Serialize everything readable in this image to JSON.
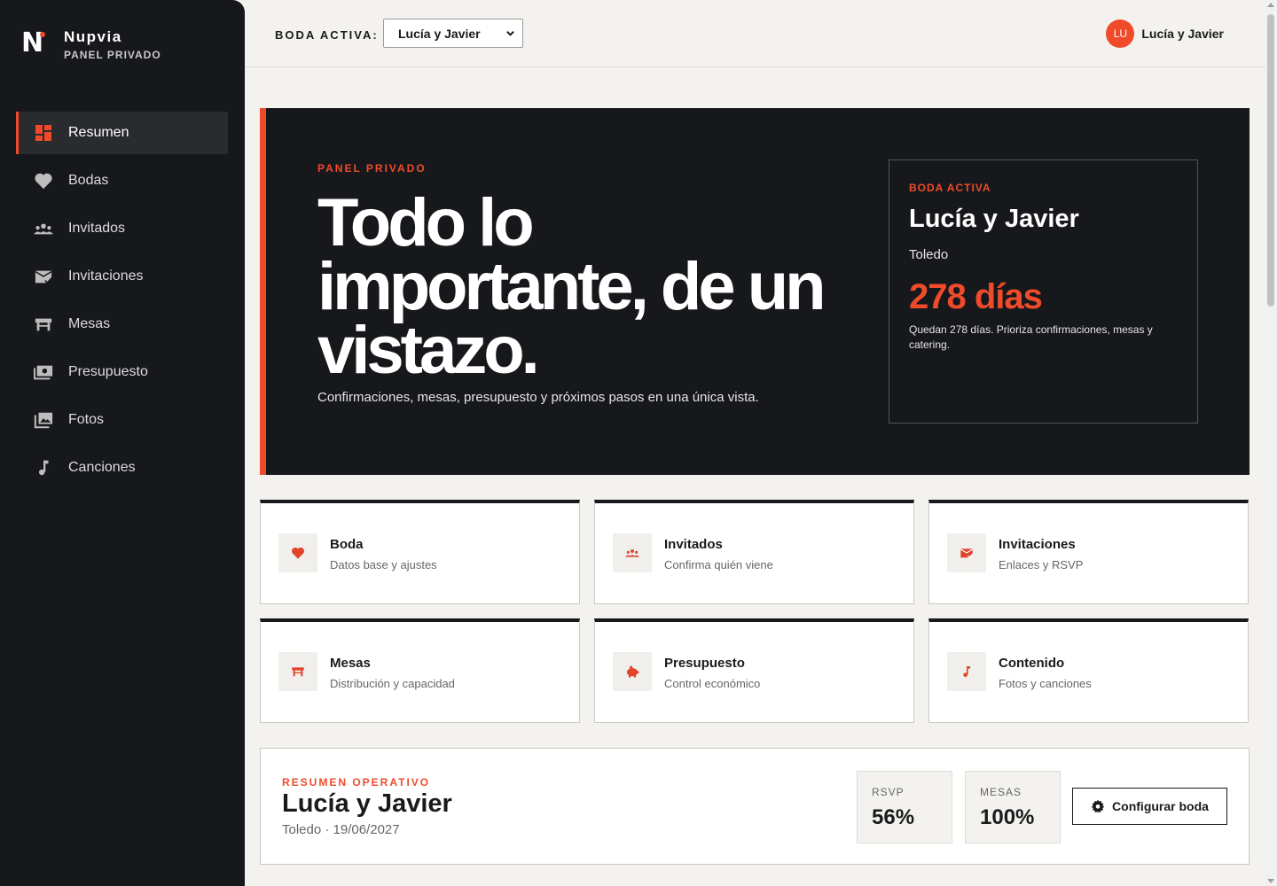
{
  "brand": {
    "name": "Nupvia",
    "subtitle": "PANEL PRIVADO"
  },
  "sidebar": {
    "items": [
      {
        "label": "Resumen",
        "icon": "dashboard-icon",
        "active": true
      },
      {
        "label": "Bodas",
        "icon": "heart-icon"
      },
      {
        "label": "Invitados",
        "icon": "people-icon"
      },
      {
        "label": "Invitaciones",
        "icon": "mail-check-icon"
      },
      {
        "label": "Mesas",
        "icon": "table-icon"
      },
      {
        "label": "Presupuesto",
        "icon": "money-icon"
      },
      {
        "label": "Fotos",
        "icon": "photos-icon"
      },
      {
        "label": "Canciones",
        "icon": "music-note-icon"
      }
    ]
  },
  "topbar": {
    "boda_label": "BODA ACTIVA:",
    "boda_selected": "Lucía y Javier",
    "user_initials": "LU",
    "user_name": "Lucía y Javier"
  },
  "hero": {
    "eyebrow": "PANEL PRIVADO",
    "title": "Todo lo importante, de un vistazo.",
    "subtitle": "Confirmaciones, mesas, presupuesto y próximos pasos en una única vista.",
    "card": {
      "eyebrow": "BODA ACTIVA",
      "title": "Lucía y Javier",
      "city": "Toledo",
      "days": "278 días",
      "note": "Quedan 278 días. Prioriza confirmaciones, mesas y catering."
    }
  },
  "cards": [
    {
      "title": "Boda",
      "subtitle": "Datos base y ajustes",
      "icon": "heart-icon"
    },
    {
      "title": "Invitados",
      "subtitle": "Confirma quién viene",
      "icon": "people-icon"
    },
    {
      "title": "Invitaciones",
      "subtitle": "Enlaces y RSVP",
      "icon": "mail-check-icon"
    },
    {
      "title": "Mesas",
      "subtitle": "Distribución y capacidad",
      "icon": "table-icon"
    },
    {
      "title": "Presupuesto",
      "subtitle": "Control económico",
      "icon": "piggy-bank-icon"
    },
    {
      "title": "Contenido",
      "subtitle": "Fotos y canciones",
      "icon": "music-note-icon"
    }
  ],
  "summary": {
    "eyebrow": "RESUMEN OPERATIVO",
    "title": "Lucía y Javier",
    "meta": "Toledo · 19/06/2027",
    "stats": [
      {
        "label": "RSVP",
        "value": "56%"
      },
      {
        "label": "MESAS",
        "value": "100%"
      }
    ],
    "config_button": "Configurar boda"
  },
  "colors": {
    "accent": "#ef4b2b",
    "dark": "#17181b",
    "background": "#f3f2ee"
  }
}
